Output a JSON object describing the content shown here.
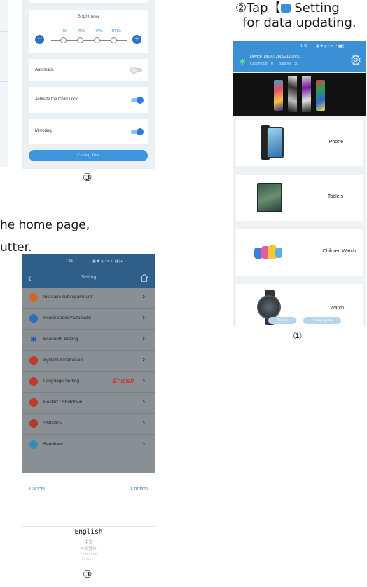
{
  "colors": {
    "accent": "#3b8fd4",
    "toggle_on": "#2a7ed6",
    "language_red": "#d81b1b",
    "bluetooth_green": "#5fe08c"
  },
  "brightness_screen": {
    "title": "Brightness",
    "percent_labels": [
      "0%",
      "25%",
      "75%",
      "100%"
    ],
    "minus_symbol": "−",
    "plus_symbol": "+",
    "automatic_label": "Automatic",
    "automatic_on": false,
    "child_lock_label": "Activate the Child Lock",
    "child_lock_on": true,
    "mirroring_label": "Mirroring",
    "mirroring_on": true,
    "cutting_test_label": "Cutting Test",
    "step_number": "③"
  },
  "instructions": {
    "left_line1": "he home page,",
    "left_line2": "utter.",
    "right_line1_prefix": "②Tap【",
    "right_line1_suffix": " Setting",
    "right_line2": "for data updating."
  },
  "home_screen": {
    "status_time": "1:43",
    "status_icons": "▣ ✱ ◎ ⁝ ᯤ ⁴ᐟ ▮▮▯+",
    "bluetooth_icon": "✱",
    "device_label": "Device",
    "device_id": "DK001280921110951",
    "cut_amount_label": "Cut amount",
    "cut_amount_value": "0",
    "balance_label": "Balance",
    "balance_value": "50",
    "categories": [
      {
        "name": "Phone",
        "icon": "phone-icon"
      },
      {
        "name": "Tablets",
        "icon": "tablet-icon"
      },
      {
        "name": "Children Watch",
        "icon": "children-watch-icon"
      },
      {
        "name": "Watch",
        "icon": "watch-icon"
      }
    ],
    "bottom_tabs": [
      "history",
      "Cutting favorite"
    ],
    "step_number": "①"
  },
  "language_screen": {
    "status_time": "1:44",
    "status_icons": "▣ ✱ ◎ ⁝ ᯤ ⁴ᐟ ▮▮▯+",
    "back_symbol": "‹",
    "title": "Setting",
    "menu": [
      {
        "label": "Increase cutting amount",
        "icon": "coin-icon",
        "color": "#d0682a",
        "value": ""
      },
      {
        "label": "Force/Speed/Automatic",
        "icon": "speed-icon",
        "color": "#2a6fc0",
        "value": ""
      },
      {
        "label": "Bluetooth Setting",
        "icon": "bluetooth-icon",
        "color": "#2a57b8",
        "value": ""
      },
      {
        "label": "System Infromation",
        "icon": "system-info-icon",
        "color": "#c0392b",
        "value": ""
      },
      {
        "label": "Language Setting",
        "icon": "globe-icon",
        "color": "#c0392b",
        "value": "English"
      },
      {
        "label": "Restart / Shutdown",
        "icon": "power-icon",
        "color": "#c0392b",
        "value": ""
      },
      {
        "label": "Statistics",
        "icon": "statistics-icon",
        "color": "#b03a2e",
        "value": ""
      },
      {
        "label": "Feedback",
        "icon": "feedback-icon",
        "color": "#2e8fb8",
        "value": ""
      }
    ],
    "arrow_symbol": "›",
    "cancel_label": "Cancel",
    "confirm_label": "Confirm",
    "language_options": [
      "English",
      "中文",
      "中文繁体",
      "Français",
      "Deutsch"
    ],
    "selected_language": "English",
    "step_number": "③"
  }
}
